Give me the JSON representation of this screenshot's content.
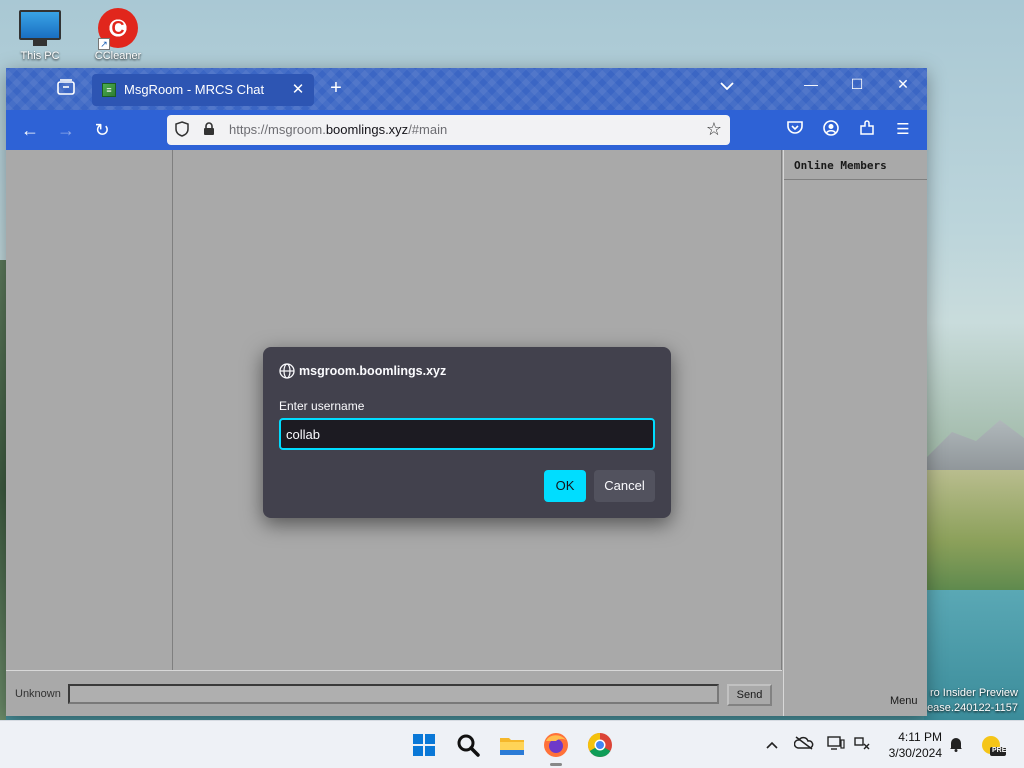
{
  "desktop": {
    "icons": [
      {
        "label": "This PC",
        "icon": "monitor-icon"
      },
      {
        "label": "CCleaner",
        "icon": "ccleaner-icon"
      }
    ],
    "watermark_line1": "ro Insider Preview",
    "watermark_line2": "ease.240122-1157"
  },
  "browser": {
    "tab_title": "MsgRoom - MRCS Chat",
    "url_prefix": "https://msgroom.",
    "url_host": "boomlings.xyz",
    "url_suffix": "/#main",
    "accent_color": "#2e62d6"
  },
  "page": {
    "members_title": "Online Members",
    "menu_label": "Menu",
    "username_label": "Unknown",
    "message_value": "",
    "send_label": "Send"
  },
  "dialog": {
    "origin": "msgroom.boomlings.xyz",
    "prompt": "Enter username",
    "input_value": "collab",
    "ok_label": "OK",
    "cancel_label": "Cancel",
    "accent_color": "#00ddff"
  },
  "taskbar": {
    "apps": [
      "start-icon",
      "search-icon",
      "file-explorer-icon",
      "firefox-icon",
      "chrome-icon"
    ],
    "time": "4:11 PM",
    "date": "3/30/2024",
    "badge": "PRE"
  }
}
